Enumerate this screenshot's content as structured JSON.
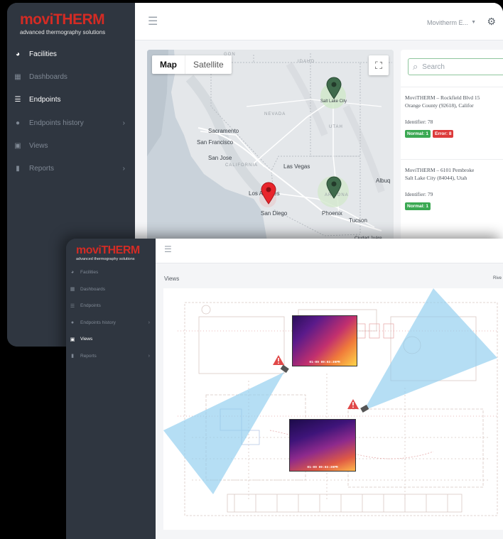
{
  "brand": {
    "logo_text": "moviTHERM",
    "tagline": "advanced thermography solutions",
    "color": "#d42b24"
  },
  "window_main": {
    "sidebar": {
      "items": [
        {
          "label": "Facilities",
          "icon": "globe-icon",
          "active": true
        },
        {
          "label": "Dashboards",
          "icon": "bar-chart-icon",
          "active": false
        },
        {
          "label": "Endpoints",
          "icon": "list-icon",
          "active": false,
          "bright": true
        },
        {
          "label": "Endpoints history",
          "icon": "clock-icon",
          "active": false,
          "has_submenu": true
        },
        {
          "label": "Views",
          "icon": "image-icon",
          "active": false
        },
        {
          "label": "Reports",
          "icon": "document-icon",
          "active": false,
          "has_submenu": true
        }
      ]
    },
    "topbar": {
      "user": "Movitherm E...",
      "menu_icon": "hamburger-icon",
      "settings_icon": "gear-icon"
    },
    "map": {
      "type_buttons": [
        "Map",
        "Satellite"
      ],
      "selected": "Map",
      "labels": {
        "sacramento": "Sacramento",
        "san_francisco": "San Francisco",
        "san_jose": "San Jose",
        "california": "CALIFORNIA",
        "las_vegas": "Las Vegas",
        "nevada": "NEVADA",
        "utah": "UTAH",
        "arizona": "ARIZONA",
        "los_angeles": "Los Angeles",
        "san_diego": "San Diego",
        "phoenix": "Phoenix",
        "tucson": "Tucson",
        "idaho": "IDAHO",
        "oregon": "GON",
        "salt_lake": "Salt Lake City",
        "albuquerque": "Albuq",
        "ciudad_juarez": "Ciudad Juáre"
      },
      "markers": [
        {
          "name": "salt-lake-marker",
          "color": "#3f6b4c"
        },
        {
          "name": "arizona-marker",
          "color": "#3f6b4c"
        },
        {
          "name": "orange-county-marker",
          "color": "#e8252c"
        }
      ]
    },
    "panel": {
      "search_placeholder": "Search",
      "items": [
        {
          "address_line1": "MoviTHERM – Rockfield Blvd 15",
          "address_line2": "Orange County (92618), Califor",
          "identifier": "Identifier: 78",
          "badges": [
            {
              "text": "Normal: 1",
              "kind": "ok"
            },
            {
              "text": "Error: 8",
              "kind": "err"
            }
          ]
        },
        {
          "address_line1": "MoviTHERM – 6101 Pembroke",
          "address_line2": "Salt Lake City (84044), Utah",
          "identifier": "Identifier: 79",
          "badges": [
            {
              "text": "Normal: 1",
              "kind": "ok"
            }
          ]
        }
      ]
    }
  },
  "window_views": {
    "sidebar": {
      "items": [
        {
          "label": "Facilities",
          "icon": "globe-icon",
          "active": false
        },
        {
          "label": "Dashboards",
          "icon": "bar-chart-icon",
          "active": false
        },
        {
          "label": "Endpoints",
          "icon": "list-icon",
          "active": false
        },
        {
          "label": "Endpoints history",
          "icon": "clock-icon",
          "active": false,
          "has_submenu": true
        },
        {
          "label": "Views",
          "icon": "image-icon",
          "active": true
        },
        {
          "label": "Reports",
          "icon": "document-icon",
          "active": false,
          "has_submenu": true
        }
      ]
    },
    "page_title": "Views",
    "right_label": "Rive",
    "thermal_images": [
      {
        "timestamp": "01-09 09:03:39PM"
      },
      {
        "timestamp": "01-09 09:03:39PM"
      }
    ],
    "colors": {
      "camera_fov": "#8ecdee",
      "warning": "#e04848"
    }
  }
}
